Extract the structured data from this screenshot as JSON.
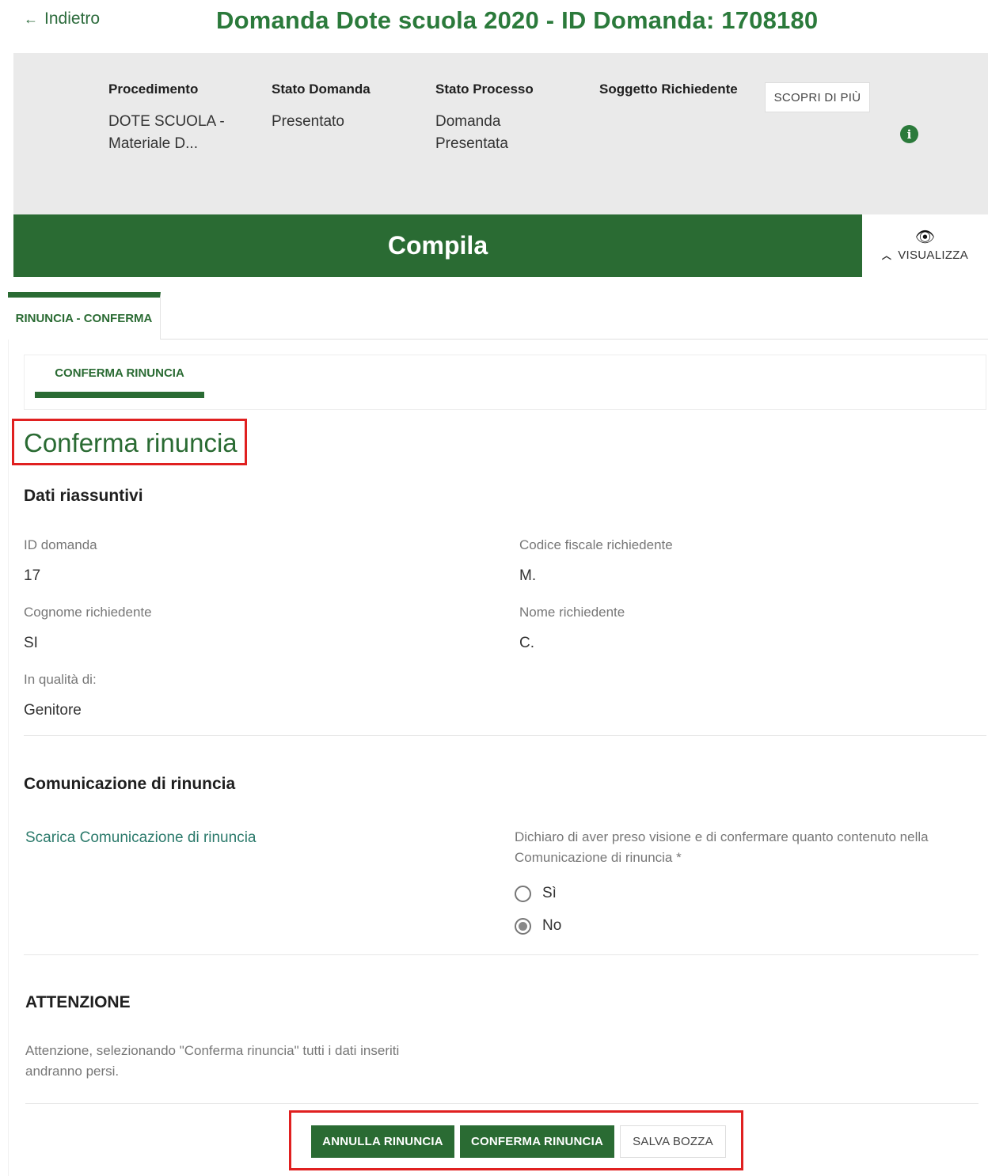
{
  "header": {
    "back_label": "Indietro",
    "title": "Domanda Dote scuola 2020 - ID Domanda: 1708180"
  },
  "info_panel": {
    "procedimento_label": "Procedimento",
    "procedimento_value": "DOTE SCUOLA - Materiale D...",
    "stato_domanda_label": "Stato Domanda",
    "stato_domanda_value": "Presentato",
    "stato_processo_label": "Stato Processo",
    "stato_processo_value": "Domanda Presentata",
    "soggetto_label": "Soggetto Richiedente",
    "scopri_label": "SCOPRI DI PIÙ",
    "info_icon": "i"
  },
  "compila_bar": {
    "label": "Compila",
    "visualizza_label": "VISUALIZZA",
    "visualizza_icon": "eye-icon"
  },
  "tabs": {
    "main": "RINUNCIA - CONFERMA",
    "sub": "CONFERMA RINUNCIA"
  },
  "section": {
    "title": "Conferma rinuncia",
    "dati_title": "Dati riassuntivi",
    "id_label": "ID domanda",
    "id_value": "17",
    "cf_label": "Codice fiscale richiedente",
    "cf_value": "M.",
    "cognome_label": "Cognome richiedente",
    "cognome_value": "SI",
    "nome_label": "Nome richiedente",
    "nome_value": "C.",
    "qualita_label": "In qualità di:",
    "qualita_value": "Genitore"
  },
  "comunicazione": {
    "title": "Comunicazione di rinuncia",
    "download_link": "Scarica Comunicazione di rinuncia",
    "declare_text": "Dichiaro di aver preso visione e di confermare quanto contenuto nella Comunicazione di rinuncia *",
    "options": [
      "Sì",
      "No"
    ],
    "selected": "No"
  },
  "attenzione": {
    "title": "ATTENZIONE",
    "text": "Attenzione, selezionando \"Conferma rinuncia\" tutti i dati inseriti andranno persi."
  },
  "actions": {
    "annulla": "ANNULLA RINUNCIA",
    "conferma": "CONFERMA RINUNCIA",
    "salva": "SALVA BOZZA"
  },
  "colors": {
    "brand_green": "#2a6b33",
    "highlight_red": "#e02020"
  }
}
